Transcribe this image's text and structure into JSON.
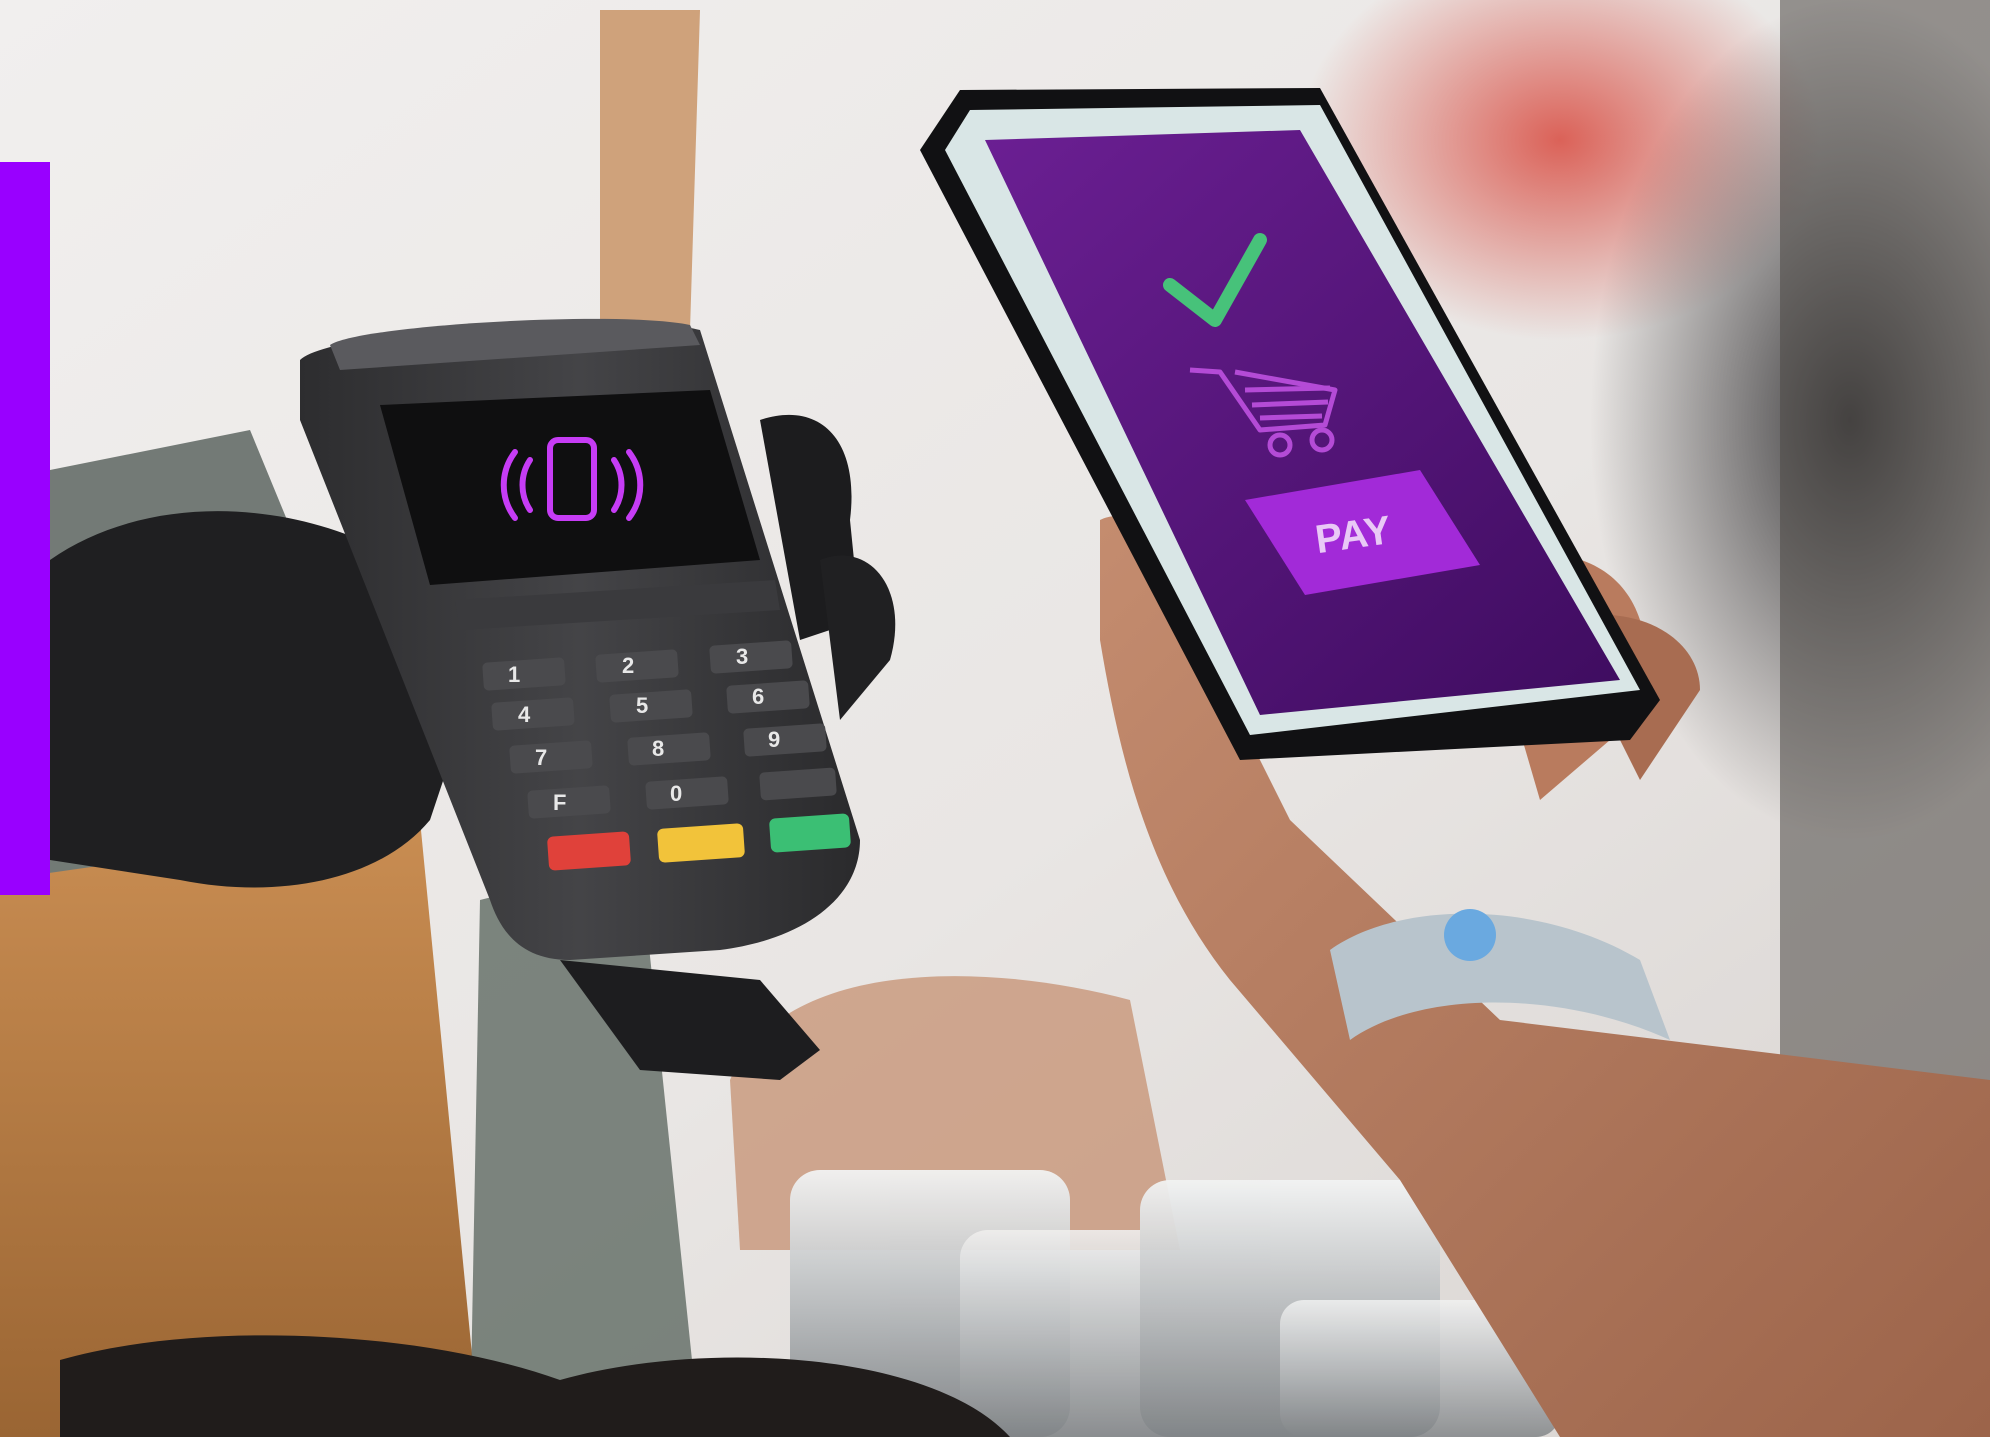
{
  "accent_bar": {
    "color": "#9900FF"
  },
  "phone_screen": {
    "pay_label": "PAY",
    "icons": [
      "check-icon",
      "shopping-cart-icon"
    ],
    "screen_color": "#5a1480",
    "pay_button_color": "#a22ad8",
    "check_color": "#47c27a"
  },
  "terminal": {
    "screen_icon": "contactless-phone-icon",
    "screen_icon_color": "#c63cf5",
    "keys": [
      "1",
      "2",
      "3",
      "4",
      "5",
      "6",
      "7",
      "8",
      "9",
      "F",
      "0",
      ""
    ],
    "function_keys": [
      {
        "name": "cancel",
        "color": "#e0413a"
      },
      {
        "name": "clear",
        "color": "#f2c33a"
      },
      {
        "name": "enter",
        "color": "#3bbf74"
      }
    ]
  }
}
